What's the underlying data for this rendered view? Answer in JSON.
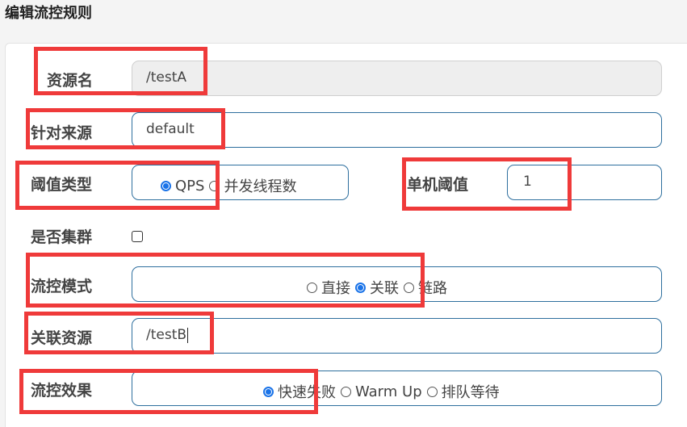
{
  "dialog": {
    "title": "编辑流控规则"
  },
  "form": {
    "resource": {
      "label": "资源名",
      "value": "/testA"
    },
    "limit_app": {
      "label": "针对来源",
      "value": "default"
    },
    "grade": {
      "label": "阈值类型",
      "options": [
        "QPS",
        "并发线程数"
      ],
      "selected": "QPS"
    },
    "count": {
      "label": "单机阈值",
      "value": "1"
    },
    "cluster": {
      "label": "是否集群",
      "checked": false
    },
    "strategy": {
      "label": "流控模式",
      "options": [
        "直接",
        "关联",
        "链路"
      ],
      "selected": "关联"
    },
    "ref_resource": {
      "label": "关联资源",
      "value": "/testB"
    },
    "control_behavior": {
      "label": "流控效果",
      "options": [
        "快速失败",
        "Warm Up",
        "排队等待"
      ],
      "selected": "快速失败"
    }
  },
  "colors": {
    "highlight": "#ef3a3a",
    "radio_checked": "#1a73e8",
    "field_border": "#2e6f9e"
  }
}
